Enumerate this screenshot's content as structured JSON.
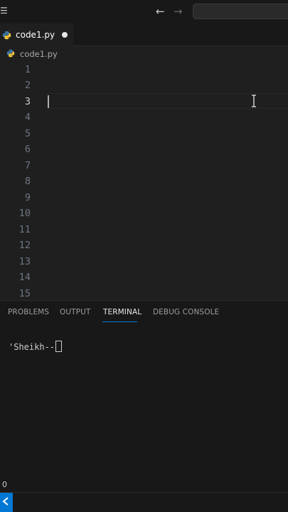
{
  "window": {
    "nav_back_icon": "arrow-left-icon",
    "nav_forward_icon": "arrow-right-icon"
  },
  "tabs": [
    {
      "label": "code1.py",
      "icon": "python-icon",
      "modified": true,
      "active": true
    }
  ],
  "breadcrumb": {
    "file": "code1.py"
  },
  "editor": {
    "line_numbers": [
      "1",
      "2",
      "3",
      "4",
      "5",
      "6",
      "7",
      "8",
      "9",
      "10",
      "11",
      "12",
      "13",
      "14",
      "15"
    ],
    "active_line": 3
  },
  "panel": {
    "tabs": [
      "PROBLEMS",
      "OUTPUT",
      "TERMINAL",
      "DEBUG CONSOLE"
    ],
    "active_tab": "TERMINAL",
    "terminal_text": "'Sheikh--"
  },
  "status": {
    "count": "0"
  },
  "colors": {
    "accent": "#0078d4",
    "background": "#1f1f1f",
    "panel": "#181818"
  }
}
